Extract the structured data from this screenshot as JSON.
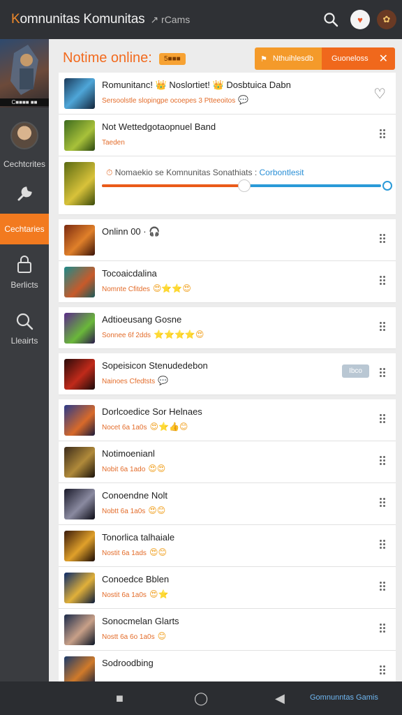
{
  "app": {
    "title_prefix": "K",
    "title_rest": "omnunitas Komunitas",
    "subtitle": "↗ rCams"
  },
  "sidebar": {
    "thumb_caption": "C■■■■ ■■",
    "items": [
      {
        "label": "Cechtcrites"
      },
      {
        "label": "Cechtaries"
      },
      {
        "label": "Berlicts"
      },
      {
        "label": "Lleairts"
      }
    ]
  },
  "header": {
    "title": "Notime online:",
    "badge": "5■■■",
    "btn_primary": "Nthuihlesdb",
    "btn_secondary": "Guoneloss"
  },
  "rows": [
    {
      "name": "Romunitanc! 👑 Noslortiet! 👑 Dosbtuica Dabn",
      "meta": "Sersoolstle slopingpe ocoepes 3 Ptteeoitos",
      "meta_emoji": "💬",
      "type": "heart"
    },
    {
      "name": "Not Wettedgotaopnuel Band",
      "meta": "Taeden",
      "meta_emoji": "",
      "type": "drag"
    },
    {
      "type": "slider",
      "text": "Nomaekio se Komnunitas Sonathiats : ",
      "text_link": "Corbontlesit"
    },
    {
      "name": "Onlinn 00  ·  🎧",
      "meta": "",
      "meta_emoji": "",
      "type": "drag"
    },
    {
      "name": "Tocoaicdalina",
      "meta": "Nomnte Cfitdes",
      "meta_emoji": "😍⭐⭐😍",
      "type": "drag"
    },
    {
      "name": "Adtioeusang Gosne",
      "meta": "Sonnee 6f 2dds",
      "meta_emoji": "⭐⭐⭐⭐😍",
      "type": "drag"
    },
    {
      "name": "Sopeisicon Stenudedebon",
      "meta": "Nainoes Cfedtsts",
      "meta_emoji": "💬",
      "type": "pill",
      "pill": "Ibco"
    },
    {
      "name": "Dorlcoedice Sor Helnaes",
      "meta": "Nocet 6a 1a0s",
      "meta_emoji": "😍⭐👍😊",
      "type": "drag"
    },
    {
      "name": "Notimoenianl",
      "meta": "Nobit 6a 1ado",
      "meta_emoji": "😍😍",
      "type": "drag"
    },
    {
      "name": "Conoendne Nolt",
      "meta": "Nobtt 6a 1a0s",
      "meta_emoji": "😍😊",
      "type": "drag"
    },
    {
      "name": "Tonorlica talhaiale",
      "meta": "Nostit 6a 1ads",
      "meta_emoji": "😍😊",
      "type": "drag"
    },
    {
      "name": "Conoedce Bblen",
      "meta": "Nostit 6a 1a0s",
      "meta_emoji": "😍⭐",
      "type": "drag"
    },
    {
      "name": "Sonocmelan Glarts",
      "meta": "Nostt 6a 6o 1a0s",
      "meta_emoji": "😊",
      "type": "drag"
    },
    {
      "name": "Sodroodbing",
      "meta": "",
      "meta_emoji": "",
      "type": "drag"
    }
  ],
  "slider": {
    "value_fraction": 0.51
  },
  "bottom_nav": {
    "cta": "Gomnunntas Gamis"
  },
  "colors": {
    "accent": "#f27a1f",
    "link": "#2a8fd6"
  }
}
